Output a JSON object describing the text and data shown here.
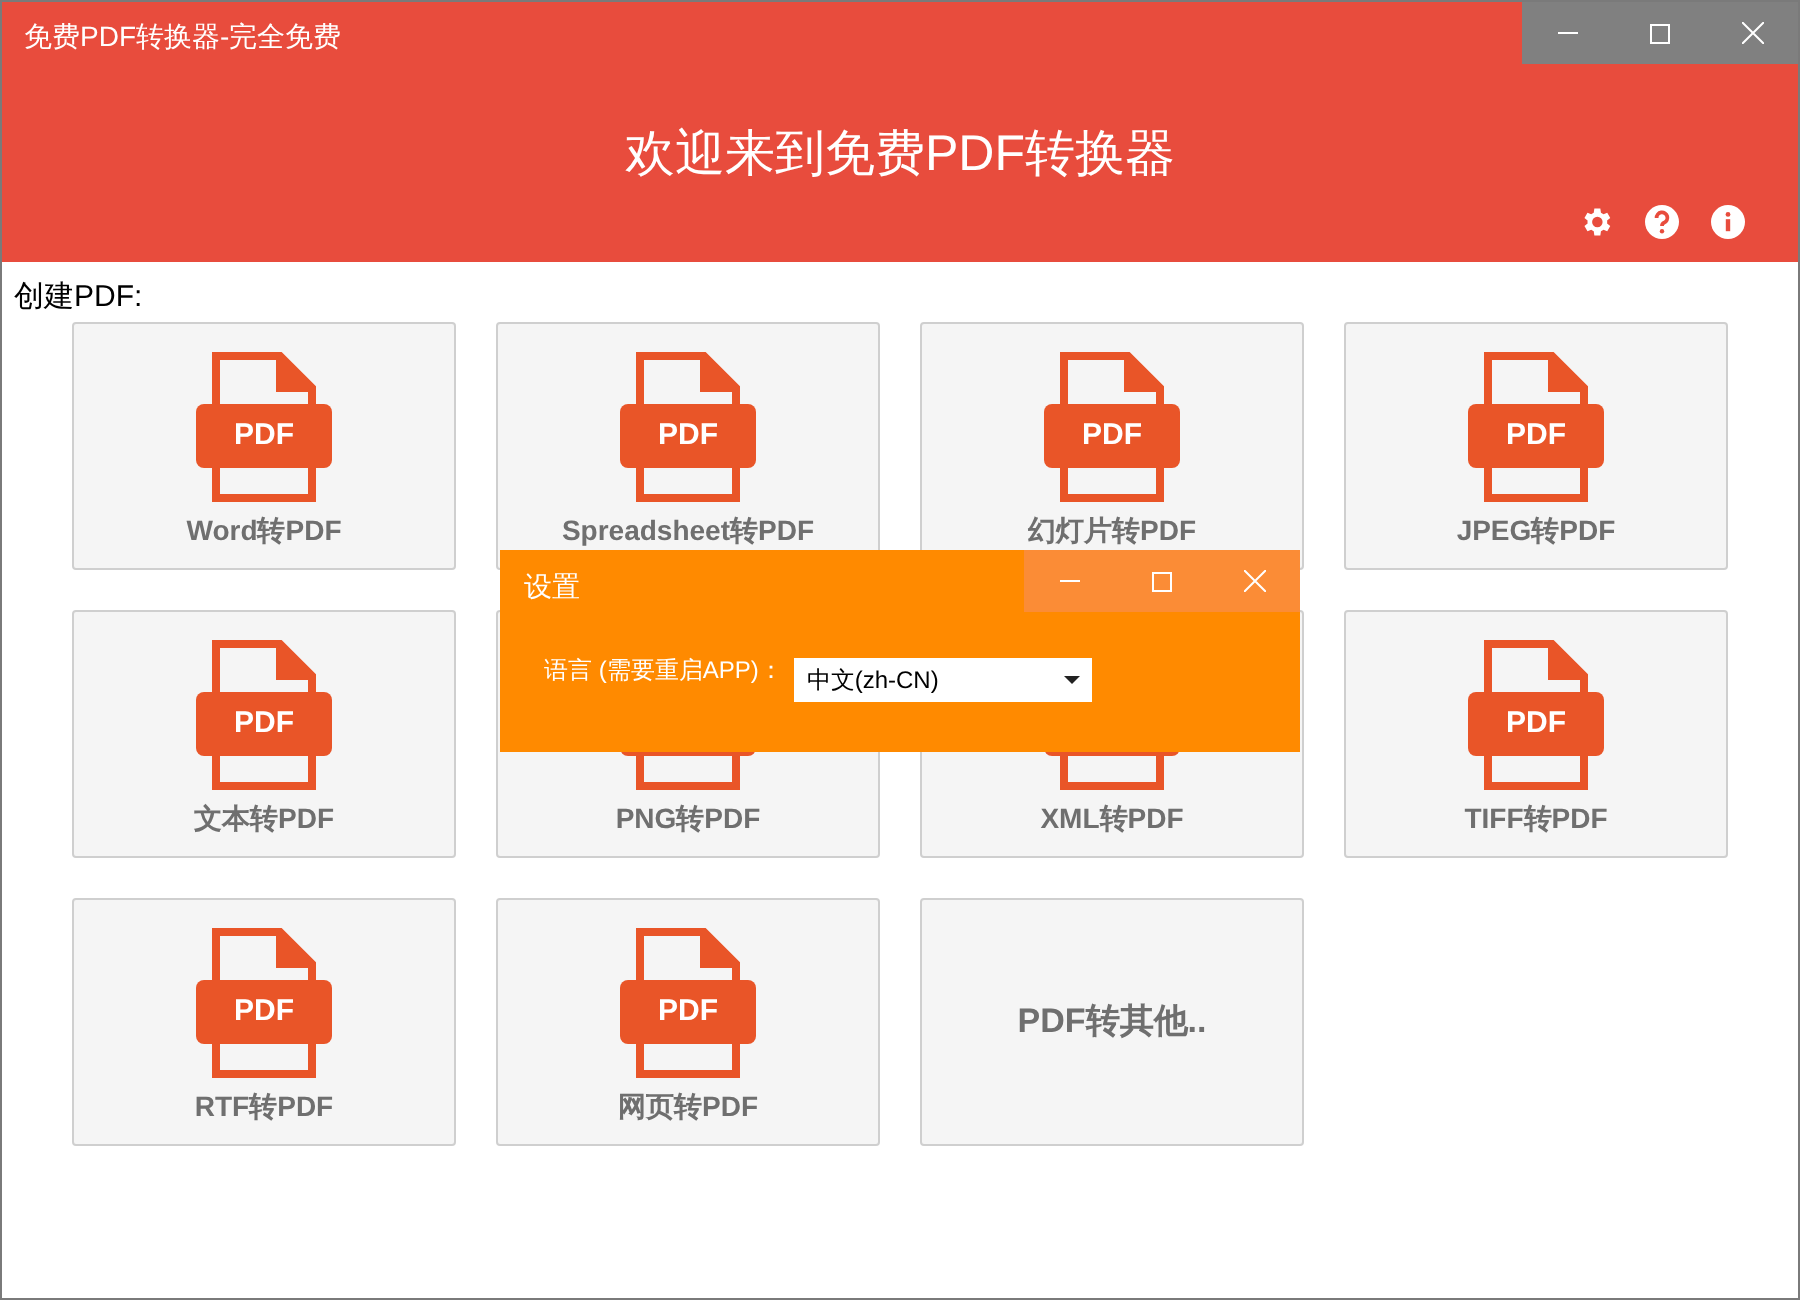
{
  "window": {
    "title": "免费PDF转换器-完全免费"
  },
  "header": {
    "title": "欢迎来到免费PDF转换器"
  },
  "section_label": "创建PDF:",
  "tiles": [
    {
      "kind": "file",
      "icon_label": "PDF",
      "label": "Word转PDF"
    },
    {
      "kind": "file",
      "icon_label": "PDF",
      "label": "Spreadsheet转PDF"
    },
    {
      "kind": "file",
      "icon_label": "PDF",
      "label": "幻灯片转PDF"
    },
    {
      "kind": "file",
      "icon_label": "PDF",
      "label": "JPEG转PDF"
    },
    {
      "kind": "file",
      "icon_label": "PDF",
      "label": "文本转PDF"
    },
    {
      "kind": "file",
      "label": "PNG转PDF"
    },
    {
      "kind": "file",
      "label": "XML转PDF"
    },
    {
      "kind": "file",
      "icon_label": "PDF",
      "label": "TIFF转PDF"
    },
    {
      "kind": "file",
      "icon_label": "PDF",
      "label": "RTF转PDF"
    },
    {
      "kind": "file",
      "icon_label": "PDF",
      "label": "网页转PDF"
    },
    {
      "kind": "text",
      "label": "PDF转其他.."
    }
  ],
  "dialog": {
    "title": "设置",
    "language_label": "语言 (需要重启APP)：",
    "language_value": "中文(zh-CN)"
  }
}
